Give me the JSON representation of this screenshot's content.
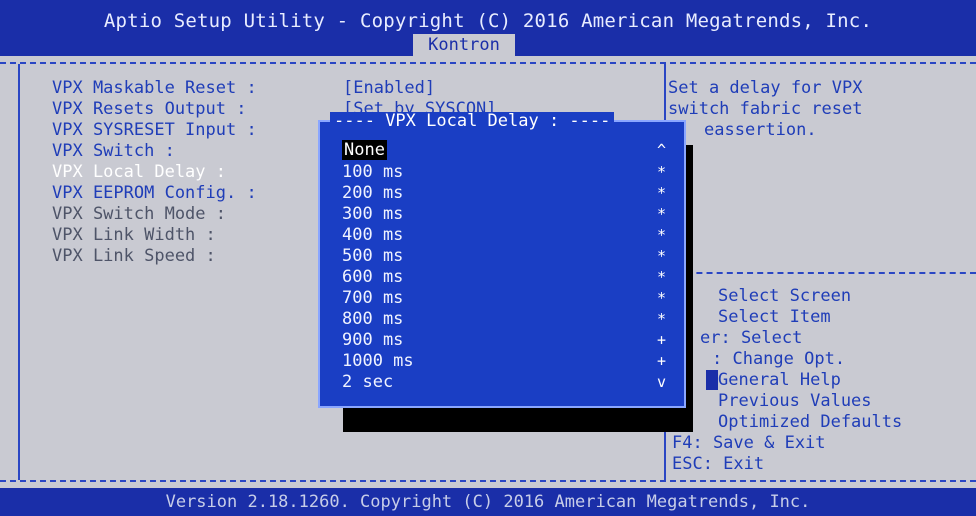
{
  "header": {
    "title": "Aptio Setup Utility - Copyright (C) 2016 American Megatrends, Inc.",
    "tab": "Kontron"
  },
  "settings": [
    {
      "label": "VPX Maskable Reset :",
      "value": "[Enabled]"
    },
    {
      "label": "VPX Resets Output :",
      "value": "[Set by SYSCON]"
    },
    {
      "label": "VPX SYSRESET Input :",
      "value": ""
    },
    {
      "label": "VPX Switch :",
      "value": ""
    },
    {
      "label": "VPX Local Delay :",
      "value": ""
    },
    {
      "label": "VPX EEPROM Config. :",
      "value": ""
    },
    {
      "label": "VPX Switch Mode :",
      "value": ""
    },
    {
      "label": "VPX Link Width :",
      "value": ""
    },
    {
      "label": "VPX Link Speed :",
      "value": ""
    }
  ],
  "help": {
    "description": [
      "Set a delay for VPX",
      "switch fabric reset",
      "eassertion."
    ],
    "keys": [
      "Select Screen",
      "Select Item",
      "er: Select",
      ": Change Opt.",
      "General Help",
      "Previous Values",
      "Optimized Defaults",
      "F4: Save & Exit",
      "ESC: Exit"
    ]
  },
  "popup": {
    "title": "VPX Local Delay :",
    "options": [
      {
        "label": "None",
        "mark": "^"
      },
      {
        "label": "100 ms",
        "mark": "*"
      },
      {
        "label": "200 ms",
        "mark": "*"
      },
      {
        "label": "300 ms",
        "mark": "*"
      },
      {
        "label": "400 ms",
        "mark": "*"
      },
      {
        "label": "500 ms",
        "mark": "*"
      },
      {
        "label": "600 ms",
        "mark": "*"
      },
      {
        "label": "700 ms",
        "mark": "*"
      },
      {
        "label": "800 ms",
        "mark": "*"
      },
      {
        "label": "900 ms",
        "mark": "+"
      },
      {
        "label": "1000 ms",
        "mark": "+"
      },
      {
        "label": "2 sec",
        "mark": "v"
      }
    ],
    "selected": "None"
  },
  "footer": {
    "version": "Version 2.18.1260. Copyright (C) 2016 American Megatrends, Inc."
  }
}
